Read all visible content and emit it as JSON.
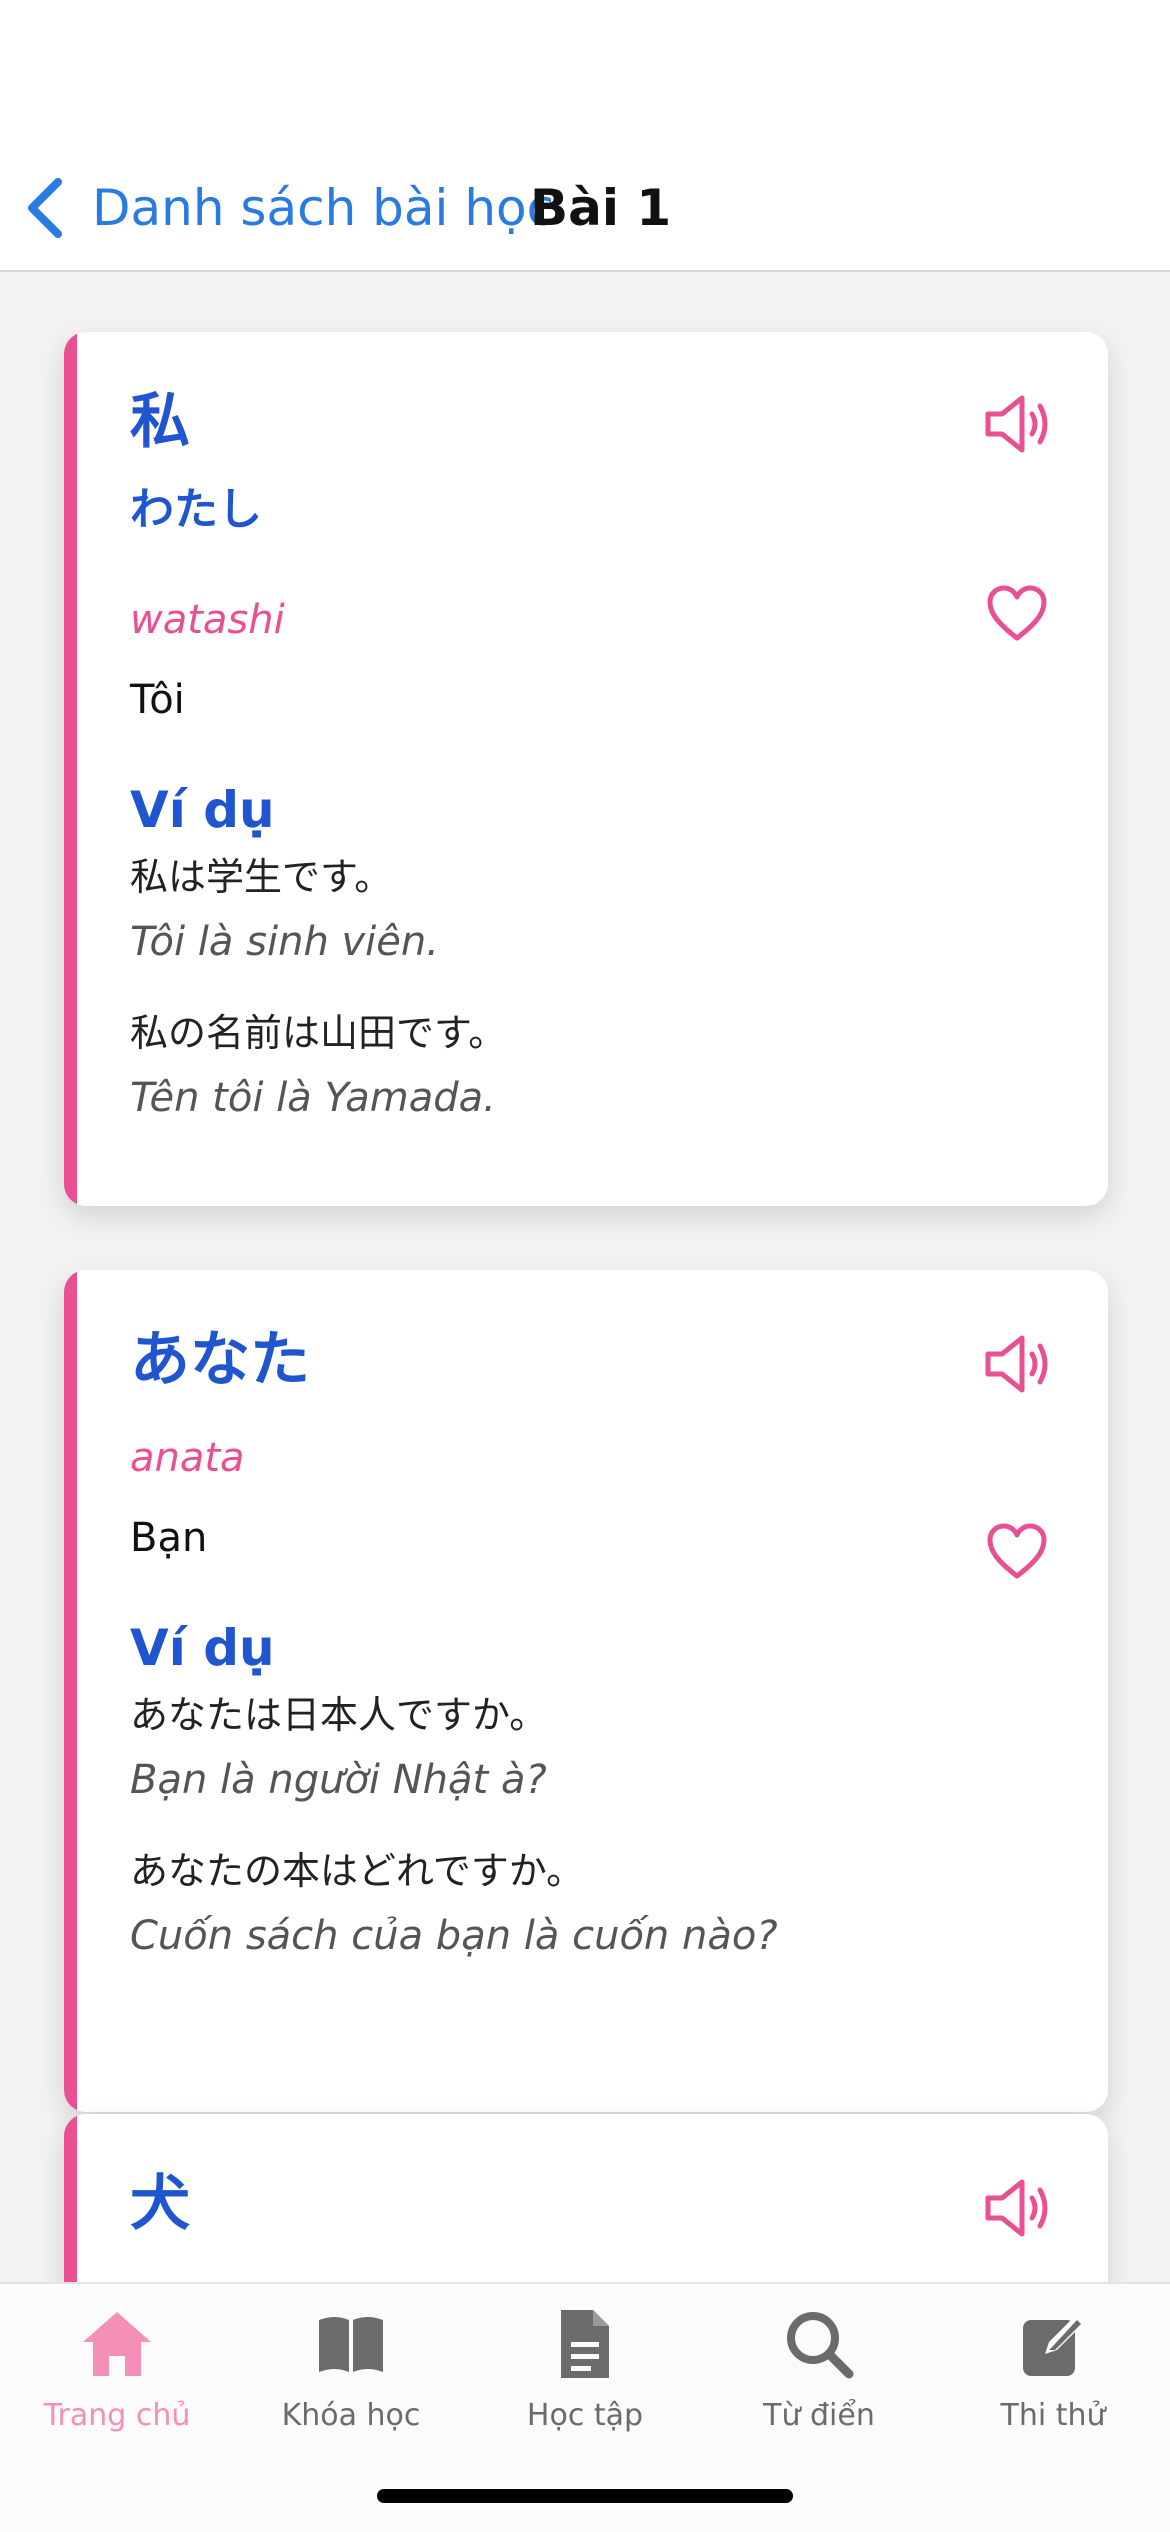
{
  "header": {
    "back_label": "Danh sách bài học",
    "title": "Bài 1"
  },
  "colors": {
    "accent_blue": "#1f56cf",
    "link_blue": "#2a7ae4",
    "accent_pink": "#e94f93",
    "tab_active": "#f48fb7"
  },
  "cards": [
    {
      "word": "私",
      "kana": "わたし",
      "romaji": "watashi",
      "meaning": "Tôi",
      "example_heading": "Ví dụ",
      "examples": [
        {
          "jp": "私は学生です。",
          "vi": "Tôi là sinh viên."
        },
        {
          "jp": "私の名前は山田です。",
          "vi": "Tên tôi là Yamada."
        }
      ]
    },
    {
      "word": "あなた",
      "romaji": "anata",
      "meaning": "Bạn",
      "example_heading": "Ví dụ",
      "examples": [
        {
          "jp": "あなたは日本人ですか。",
          "vi": "Bạn là người Nhật à?"
        },
        {
          "jp": "あなたの本はどれですか。",
          "vi": "Cuốn sách của bạn là cuốn nào?"
        }
      ]
    },
    {
      "word": "犬"
    }
  ],
  "tabs": [
    {
      "label": "Trang chủ",
      "icon": "home-icon",
      "active": true
    },
    {
      "label": "Khóa học",
      "icon": "book-icon",
      "active": false
    },
    {
      "label": "Học tập",
      "icon": "document-icon",
      "active": false
    },
    {
      "label": "Từ điển",
      "icon": "search-icon",
      "active": false
    },
    {
      "label": "Thi thử",
      "icon": "edit-icon",
      "active": false
    }
  ]
}
